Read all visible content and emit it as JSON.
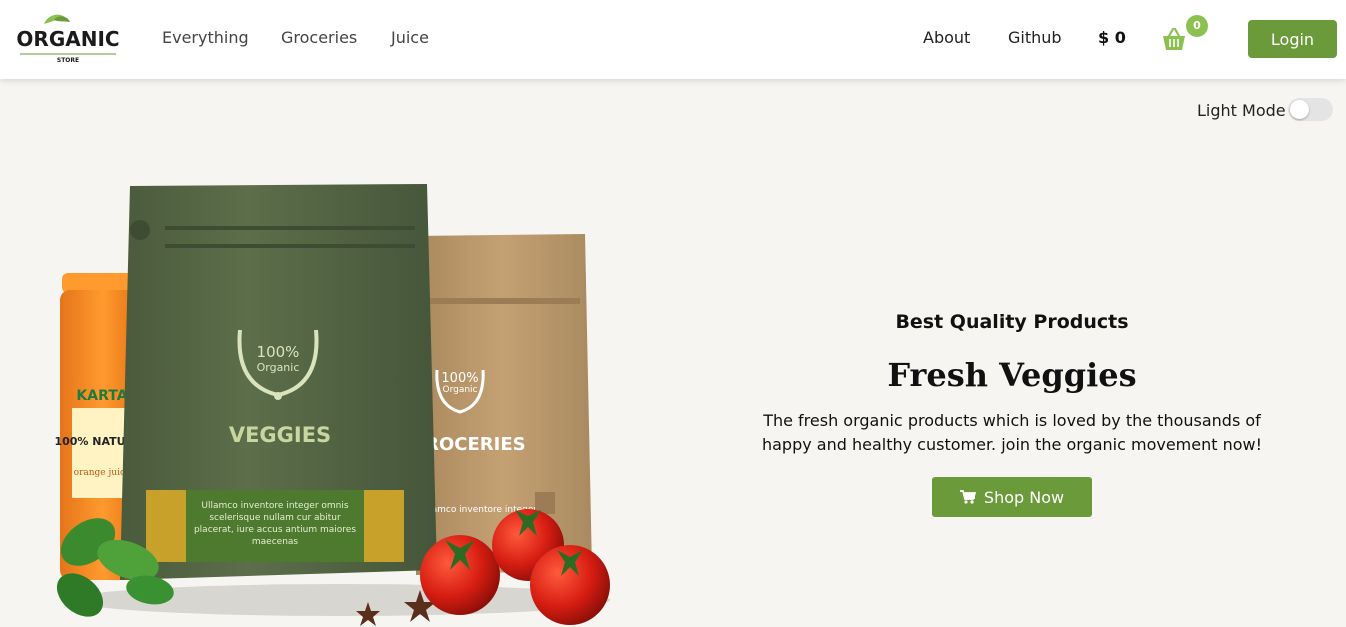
{
  "header": {
    "logo": {
      "text": "ORGANIC",
      "subtext": "STORE"
    },
    "nav": [
      "Everything",
      "Groceries",
      "Juice"
    ],
    "right_links": [
      "About",
      "Github"
    ],
    "price": "$ 0",
    "cart_count": "0",
    "login_label": "Login"
  },
  "mode": {
    "label": "Light Mode"
  },
  "hero": {
    "subtitle": "Best Quality Products",
    "title": "Fresh Veggies",
    "description": "The fresh organic products which is loved by the thousands of happy and healthy customer. join the organic movement now!",
    "button_label": "Shop Now",
    "art": {
      "bag1": {
        "badge_line1": "100%",
        "badge_line2": "Organic",
        "label": "VEGGIES",
        "text": "Ullamco inventore integer omnis scelerisque nullam cur abitur placerat, iure accus antium maiores maecenas"
      },
      "bag2": {
        "badge_line1": "100%",
        "badge_line2": "Organic",
        "label": "GROCERIES",
        "text": "Ullamco inventore integer"
      },
      "jar": {
        "brand": "KARTA",
        "claim": "100% NATURAL",
        "flavor": "orange juice"
      }
    }
  },
  "colors": {
    "accent": "#6a9a3a",
    "badge": "#8cc152",
    "background": "#f6f5f2"
  }
}
